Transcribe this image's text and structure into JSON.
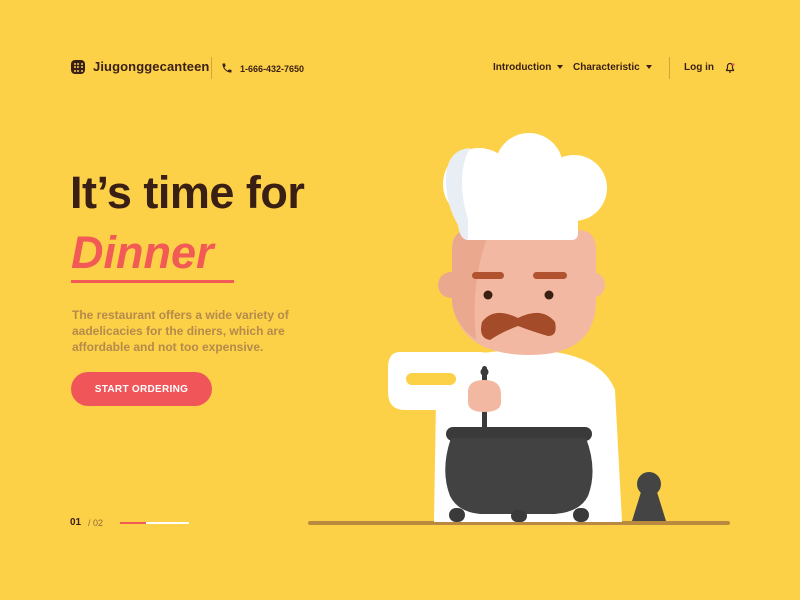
{
  "header": {
    "brand_part1": "Jiugongge",
    "brand_part2": "canteen",
    "phone": "1-666-432-7650",
    "nav": [
      {
        "label": "Introduction",
        "has_dropdown": true
      },
      {
        "label": "Characteristic",
        "has_dropdown": true
      },
      {
        "label": "Log in",
        "has_dropdown": false
      }
    ],
    "icons": {
      "logo": "grid-icon",
      "phone": "phone-icon",
      "notification": "bell-icon"
    }
  },
  "hero": {
    "title_line1": "It’s time for",
    "title_accent": "Dinner",
    "description": "The restaurant offers a wide variety of aadelicacies for the diners, which are affordable and not too expensive.",
    "cta_label": "START ORDERING"
  },
  "pager": {
    "current": "01",
    "total": "/ 02",
    "progress": 0.38
  },
  "colors": {
    "background": "#FCD148",
    "text": "#3A1F14",
    "accent": "#F15A55",
    "button": "#F05659",
    "muted": "#B58A4A"
  }
}
